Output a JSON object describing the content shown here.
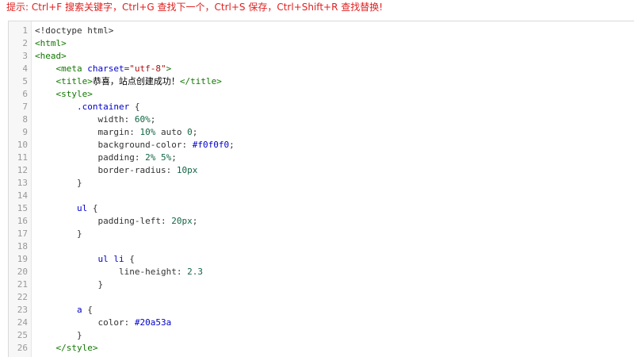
{
  "hint": "提示: Ctrl+F 搜索关键字，Ctrl+G 查找下一个，Ctrl+S 保存，Ctrl+Shift+R 查找替换!",
  "colors": {
    "hint": "#e02020",
    "tag": "#117700",
    "attr": "#0000cc",
    "string": "#aa1111",
    "number": "#116644"
  },
  "lines": [
    {
      "n": "1",
      "indent": 0,
      "tokens": [
        {
          "t": "plain",
          "v": "<!doctype html>"
        }
      ]
    },
    {
      "n": "2",
      "indent": 0,
      "tokens": [
        {
          "t": "tag",
          "v": "<html>"
        }
      ]
    },
    {
      "n": "3",
      "indent": 0,
      "tokens": [
        {
          "t": "tag",
          "v": "<head>"
        }
      ]
    },
    {
      "n": "4",
      "indent": 4,
      "tokens": [
        {
          "t": "tag",
          "v": "<meta "
        },
        {
          "t": "attr",
          "v": "charset"
        },
        {
          "t": "plain",
          "v": "="
        },
        {
          "t": "string",
          "v": "\"utf-8\""
        },
        {
          "t": "tag",
          "v": ">"
        }
      ]
    },
    {
      "n": "5",
      "indent": 4,
      "tokens": [
        {
          "t": "tag",
          "v": "<title>"
        },
        {
          "t": "text",
          "v": "恭喜，站点创建成功！"
        },
        {
          "t": "tag",
          "v": "</title>"
        }
      ]
    },
    {
      "n": "6",
      "indent": 4,
      "tokens": [
        {
          "t": "tag",
          "v": "<style>"
        }
      ]
    },
    {
      "n": "7",
      "indent": 8,
      "tokens": [
        {
          "t": "selector",
          "v": ".container"
        },
        {
          "t": "plain",
          "v": " {"
        }
      ]
    },
    {
      "n": "8",
      "indent": 12,
      "tokens": [
        {
          "t": "prop",
          "v": "width"
        },
        {
          "t": "plain",
          "v": ": "
        },
        {
          "t": "number",
          "v": "60%"
        },
        {
          "t": "plain",
          "v": ";"
        }
      ]
    },
    {
      "n": "9",
      "indent": 12,
      "tokens": [
        {
          "t": "prop",
          "v": "margin"
        },
        {
          "t": "plain",
          "v": ": "
        },
        {
          "t": "number",
          "v": "10%"
        },
        {
          "t": "plain",
          "v": " auto "
        },
        {
          "t": "number",
          "v": "0"
        },
        {
          "t": "plain",
          "v": ";"
        }
      ]
    },
    {
      "n": "10",
      "indent": 12,
      "tokens": [
        {
          "t": "prop",
          "v": "background-color"
        },
        {
          "t": "plain",
          "v": ": "
        },
        {
          "t": "color",
          "v": "#f0f0f0"
        },
        {
          "t": "plain",
          "v": ";"
        }
      ]
    },
    {
      "n": "11",
      "indent": 12,
      "tokens": [
        {
          "t": "prop",
          "v": "padding"
        },
        {
          "t": "plain",
          "v": ": "
        },
        {
          "t": "number",
          "v": "2%"
        },
        {
          "t": "plain",
          "v": " "
        },
        {
          "t": "number",
          "v": "5%"
        },
        {
          "t": "plain",
          "v": ";"
        }
      ]
    },
    {
      "n": "12",
      "indent": 12,
      "tokens": [
        {
          "t": "prop",
          "v": "border-radius"
        },
        {
          "t": "plain",
          "v": ": "
        },
        {
          "t": "number",
          "v": "10px"
        }
      ]
    },
    {
      "n": "13",
      "indent": 8,
      "tokens": [
        {
          "t": "plain",
          "v": "}"
        }
      ]
    },
    {
      "n": "14",
      "indent": 0,
      "tokens": []
    },
    {
      "n": "15",
      "indent": 8,
      "tokens": [
        {
          "t": "selector",
          "v": "ul"
        },
        {
          "t": "plain",
          "v": " {"
        }
      ]
    },
    {
      "n": "16",
      "indent": 12,
      "tokens": [
        {
          "t": "prop",
          "v": "padding-left"
        },
        {
          "t": "plain",
          "v": ": "
        },
        {
          "t": "number",
          "v": "20px"
        },
        {
          "t": "plain",
          "v": ";"
        }
      ]
    },
    {
      "n": "17",
      "indent": 8,
      "tokens": [
        {
          "t": "plain",
          "v": "}"
        }
      ]
    },
    {
      "n": "18",
      "indent": 0,
      "tokens": []
    },
    {
      "n": "19",
      "indent": 12,
      "tokens": [
        {
          "t": "selector",
          "v": "ul li"
        },
        {
          "t": "plain",
          "v": " {"
        }
      ]
    },
    {
      "n": "20",
      "indent": 16,
      "tokens": [
        {
          "t": "prop",
          "v": "line-height"
        },
        {
          "t": "plain",
          "v": ": "
        },
        {
          "t": "number",
          "v": "2.3"
        }
      ]
    },
    {
      "n": "21",
      "indent": 12,
      "tokens": [
        {
          "t": "plain",
          "v": "}"
        }
      ]
    },
    {
      "n": "22",
      "indent": 0,
      "tokens": []
    },
    {
      "n": "23",
      "indent": 8,
      "tokens": [
        {
          "t": "selector",
          "v": "a"
        },
        {
          "t": "plain",
          "v": " {"
        }
      ]
    },
    {
      "n": "24",
      "indent": 12,
      "tokens": [
        {
          "t": "prop",
          "v": "color"
        },
        {
          "t": "plain",
          "v": ": "
        },
        {
          "t": "color",
          "v": "#20a53a"
        }
      ]
    },
    {
      "n": "25",
      "indent": 8,
      "tokens": [
        {
          "t": "plain",
          "v": "}"
        }
      ]
    },
    {
      "n": "26",
      "indent": 4,
      "tokens": [
        {
          "t": "tag",
          "v": "</style>"
        }
      ]
    }
  ]
}
